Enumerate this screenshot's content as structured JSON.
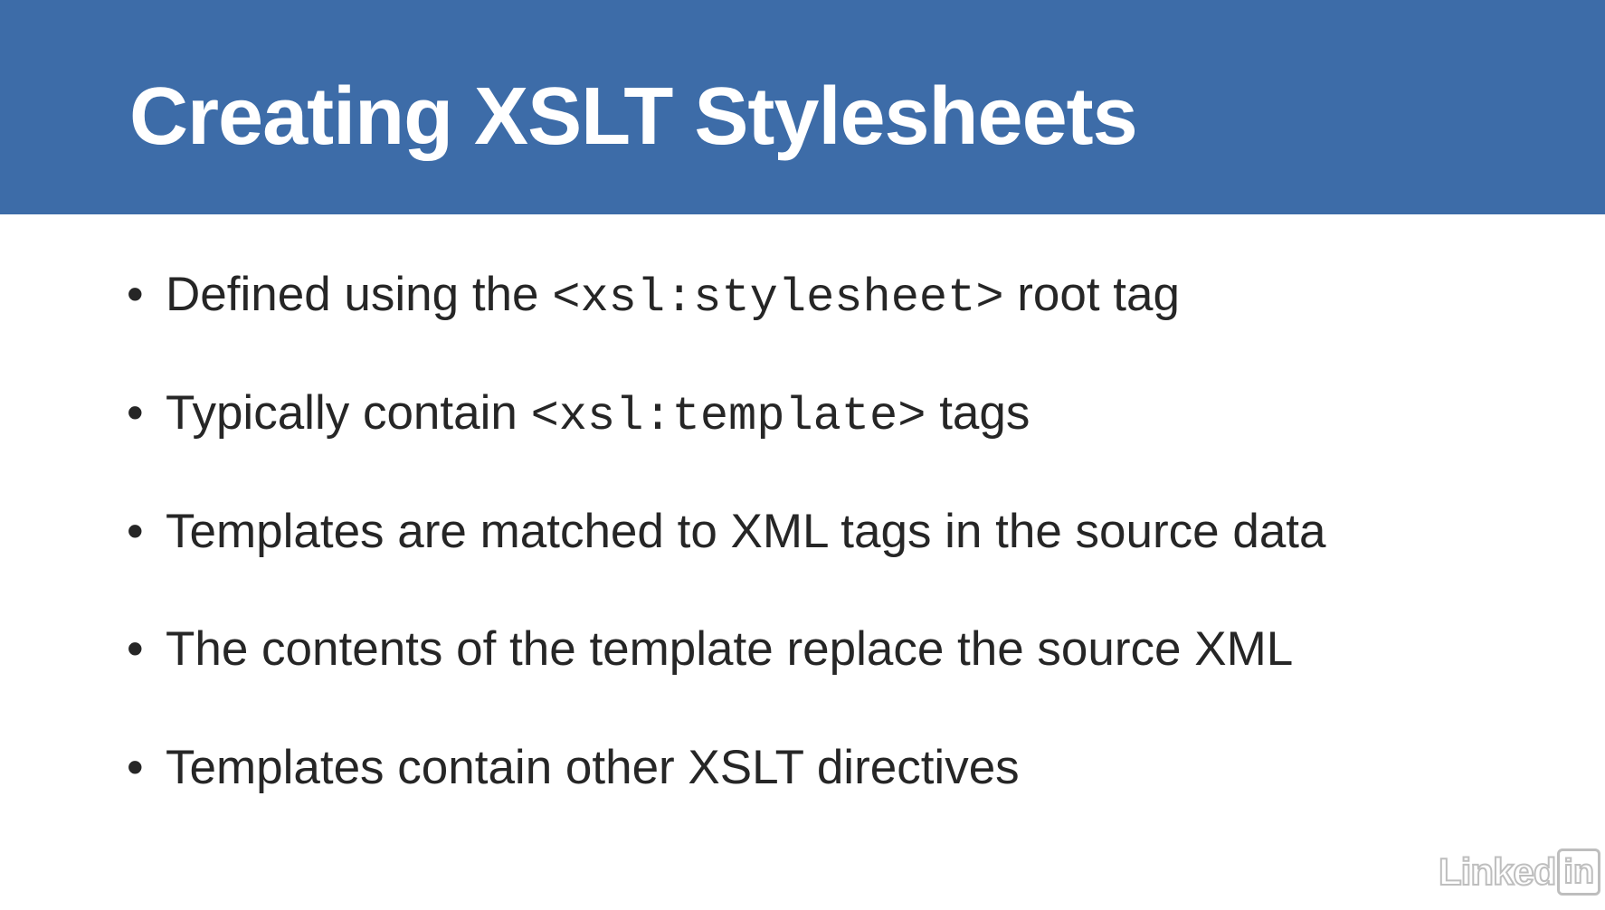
{
  "slide": {
    "title": "Creating XSLT Stylesheets",
    "bullets": [
      {
        "before": "Defined using the ",
        "code": "<xsl:stylesheet>",
        "after": " root tag"
      },
      {
        "before": "Typically contain ",
        "code": "<xsl:template>",
        "after": " tags"
      },
      {
        "before": "Templates are matched to XML tags in the source data",
        "code": "",
        "after": ""
      },
      {
        "before": "The contents of the template replace the source XML",
        "code": "",
        "after": ""
      },
      {
        "before": "Templates contain other XSLT directives",
        "code": "",
        "after": ""
      }
    ],
    "bullet_glyph": "•"
  },
  "watermark": {
    "word": "Linked",
    "box": "in"
  },
  "colors": {
    "title_bar": "#3d6ca8",
    "title_text": "#ffffff",
    "body_text": "#262626",
    "background": "#ffffff"
  }
}
